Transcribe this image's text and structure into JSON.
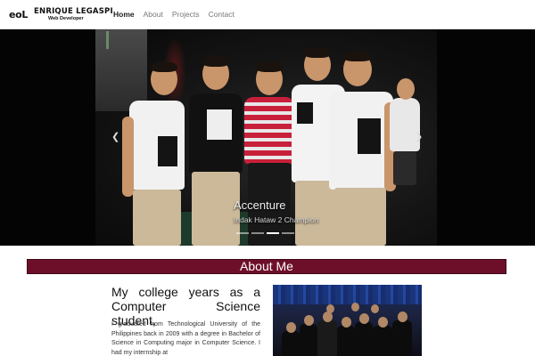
{
  "brand": {
    "mark": "eoL",
    "name": "ENRIQUE LEGASPI",
    "subtitle": "Web Developer"
  },
  "nav": {
    "items": [
      {
        "label": "Home",
        "active": true
      },
      {
        "label": "About",
        "active": false
      },
      {
        "label": "Projects",
        "active": false
      },
      {
        "label": "Contact",
        "active": false
      }
    ]
  },
  "carousel": {
    "caption_title": "Accenture",
    "caption_subtitle": "Indak Hataw 2 Champion",
    "slide_count": 4,
    "active_index": 2,
    "prev_icon": "chevron-left-icon",
    "next_icon": "chevron-right-icon",
    "prev_glyph": "❮",
    "next_glyph": "❯"
  },
  "about": {
    "section_title": "About Me",
    "heading": "My college years as a Computer Science student,",
    "paragraph": "I graduated from Technological University of the Philippines back in 2009 with a degree in Bachelor of Science in Computing major in Computer Science. I had my internship at"
  },
  "colors": {
    "accent": "#6e0f2a",
    "carousel_bg": "#040404",
    "nav_active": "#222222",
    "nav_inactive": "#777777"
  }
}
